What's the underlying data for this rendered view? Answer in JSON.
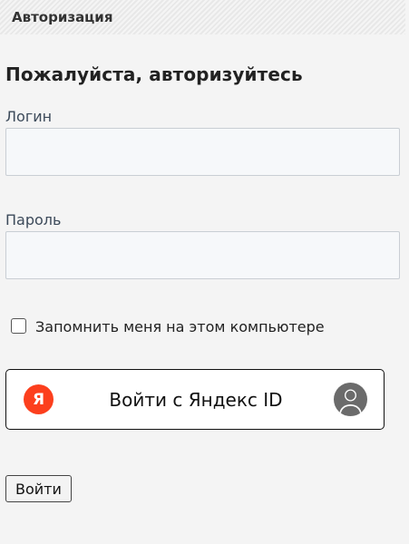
{
  "header": {
    "title": "Авторизация"
  },
  "form": {
    "heading": "Пожалуйста, авторизуйтесь",
    "login": {
      "label": "Логин",
      "value": "",
      "placeholder": ""
    },
    "password": {
      "label": "Пароль",
      "value": "",
      "placeholder": ""
    },
    "remember": {
      "label": "Запомнить меня на этом компьютере",
      "checked": false
    },
    "yandex_button": {
      "label": "Войти с Яндекс ID",
      "logo_letter": "Я",
      "logo_color": "#fc3f1d",
      "avatar_icon": "user-avatar-icon"
    },
    "submit_label": "Войти"
  }
}
